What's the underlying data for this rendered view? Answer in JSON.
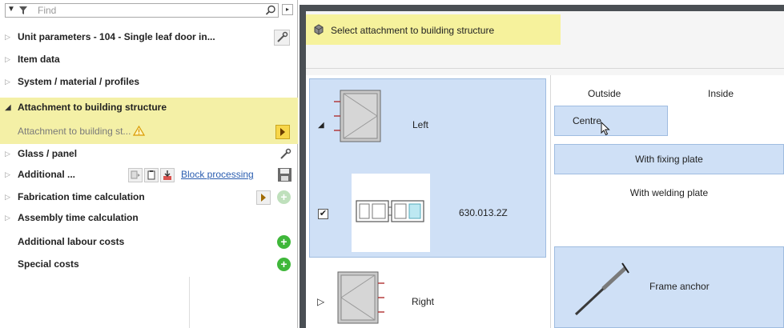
{
  "tree": {
    "search_placeholder": "Find",
    "items": [
      {
        "label": "Unit parameters - 104 - Single leaf door in...",
        "expanded": false
      },
      {
        "label": "Item data",
        "expanded": false
      },
      {
        "label": "System / material / profiles",
        "expanded": false
      },
      {
        "label": "Attachment to building structure",
        "expanded": true
      },
      {
        "label": "Attachment to building st..."
      },
      {
        "label": "Glass / panel",
        "expanded": false
      },
      {
        "label": "Additional ...",
        "expanded": false,
        "link": "Block processing"
      },
      {
        "label": "Fabrication time calculation",
        "expanded": false
      },
      {
        "label": "Assembly time calculation",
        "expanded": false
      },
      {
        "label": "Additional labour costs"
      },
      {
        "label": "Special costs"
      }
    ]
  },
  "dialog": {
    "title": "Select attachment to building structure",
    "profiles": {
      "left_label": "Left",
      "profile_number": "630.013.2Z",
      "right_label": "Right",
      "check_mark": "✔"
    },
    "options": {
      "outside": "Outside",
      "inside": "Inside",
      "centre": "Centre",
      "with_fixing_plate": "With fixing plate",
      "with_welding_plate": "With welding plate",
      "frame_anchor": "Frame anchor"
    }
  },
  "colors": {
    "highlight_yellow": "#f4f0a6",
    "selection_blue": "#cfe0f6",
    "add_green": "#3fb73a",
    "link_blue": "#2a5db0"
  },
  "icons": [
    "funnel-icon",
    "search-icon",
    "wrench-icon",
    "warning-icon",
    "save-icon",
    "plus-icon",
    "window-icon",
    "frame-anchor-icon"
  ]
}
